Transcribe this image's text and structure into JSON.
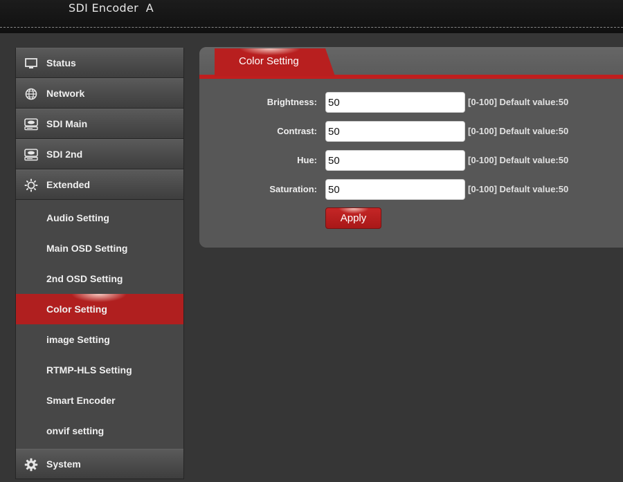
{
  "header": {
    "title": "SDI Encoder  A"
  },
  "sidebar": {
    "main_items": [
      {
        "label": "Status",
        "icon": "monitor-icon"
      },
      {
        "label": "Network",
        "icon": "globe-icon"
      },
      {
        "label": "SDI Main",
        "icon": "drive-icon"
      },
      {
        "label": "SDI 2nd",
        "icon": "drive-icon"
      },
      {
        "label": "Extended",
        "icon": "sun-gear-icon"
      }
    ],
    "sub_items": [
      {
        "label": "Audio Setting"
      },
      {
        "label": "Main OSD Setting"
      },
      {
        "label": "2nd OSD Setting"
      },
      {
        "label": "Color Setting",
        "active": true
      },
      {
        "label": "image Setting"
      },
      {
        "label": "RTMP-HLS Setting"
      },
      {
        "label": "Smart Encoder"
      },
      {
        "label": "onvif setting"
      }
    ],
    "system": {
      "label": "System",
      "icon": "gear-icon"
    }
  },
  "panel": {
    "tab_label": "Color Setting",
    "fields": [
      {
        "label": "Brightness:",
        "value": "50",
        "hint": "[0-100] Default value:50"
      },
      {
        "label": "Contrast:",
        "value": "50",
        "hint": "[0-100] Default value:50"
      },
      {
        "label": "Hue:",
        "value": "50",
        "hint": "[0-100] Default value:50"
      },
      {
        "label": "Saturation:",
        "value": "50",
        "hint": "[0-100] Default value:50"
      }
    ],
    "apply_label": "Apply"
  },
  "colors": {
    "accent": "#b81f1f",
    "background": "#363636",
    "sidebar": "#474747",
    "panel": "#575757"
  }
}
